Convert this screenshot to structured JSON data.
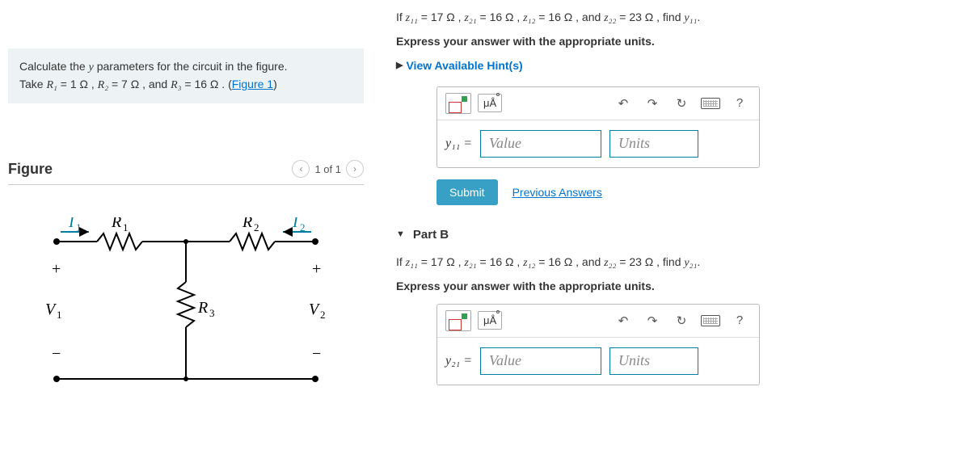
{
  "left": {
    "prompt_prefix": "Calculate the ",
    "prompt_var": "y",
    "prompt_mid": " parameters for the circuit in the figure.",
    "take": "Take ",
    "r1": "R₁",
    "r1v": " = 1 Ω , ",
    "r2": "R₂",
    "r2v": " = 7 Ω , and ",
    "r3": "R₃",
    "r3v": " = 16 Ω . (",
    "figlink": "Figure 1",
    "close": ")",
    "figure_title": "Figure",
    "pager": "1 of 1"
  },
  "circuit": {
    "I1": "I₁",
    "I2": "I₂",
    "R1": "R₁",
    "R2": "R₂",
    "R3": "R₃",
    "V1": "V₁",
    "V2": "V₂",
    "plus": "+",
    "minus": "−"
  },
  "partA": {
    "q_prefix": "If  ",
    "z11": "z₁₁",
    "z11v": " = 17 Ω , ",
    "z21": "z₂₁",
    "z21v": " = 16 Ω , ",
    "z12": "z₁₂",
    "z12v": " = 16 Ω , and ",
    "z22": "z₂₂",
    "z22v": " = 23 Ω , find ",
    "target": "y₁₁",
    "period": ".",
    "express": "Express your answer with the appropriate units.",
    "hint": "View Available Hint(s)",
    "unit_btn": "μÅ",
    "help": "?",
    "var": "y₁₁ =",
    "value_ph": "Value",
    "units_ph": "Units",
    "submit": "Submit",
    "prev": "Previous Answers"
  },
  "partB": {
    "title": "Part B",
    "q_prefix": "If  ",
    "z11": "z₁₁",
    "z11v": " = 17 Ω , ",
    "z21": "z₂₁",
    "z21v": " = 16 Ω , ",
    "z12": "z₁₂",
    "z12v": " = 16 Ω , and ",
    "z22": "z₂₂",
    "z22v": " = 23 Ω , find ",
    "target": "y₂₁",
    "period": ".",
    "express": "Express your answer with the appropriate units.",
    "unit_btn": "μÅ",
    "help": "?",
    "var": "y₂₁ =",
    "value_ph": "Value",
    "units_ph": "Units"
  }
}
